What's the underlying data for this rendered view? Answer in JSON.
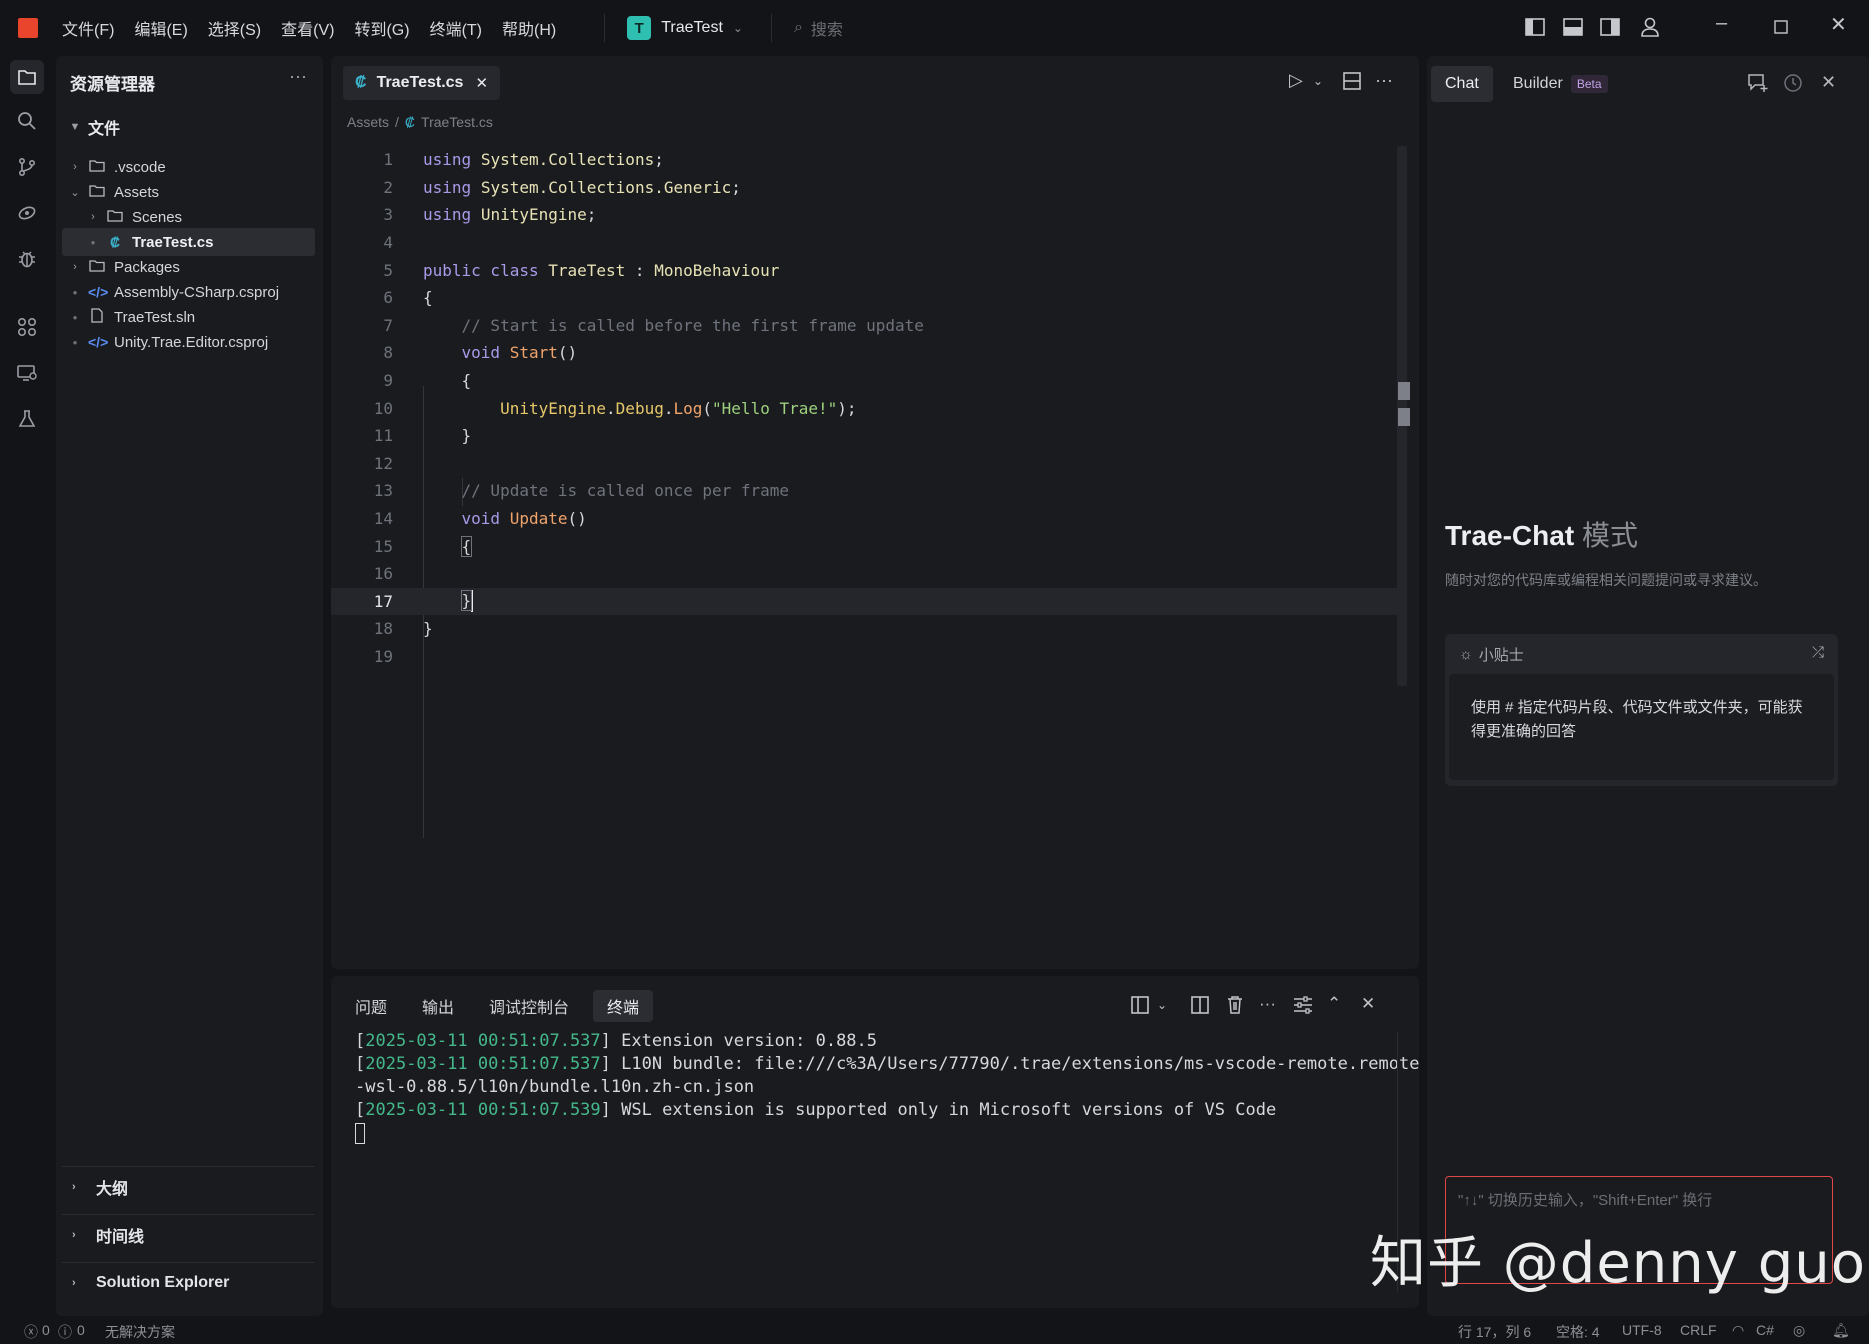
{
  "titlebar": {
    "menus": [
      "文件(F)",
      "编辑(E)",
      "选择(S)",
      "查看(V)",
      "转到(G)",
      "终端(T)",
      "帮助(H)"
    ],
    "project_badge": "T",
    "project_name": "TraeTest",
    "search_placeholder": "搜索"
  },
  "sidebar": {
    "title": "资源管理器",
    "more": "···",
    "root_label": "文件",
    "items": [
      {
        "label": ".vscode"
      },
      {
        "label": "Assets"
      },
      {
        "label": "Scenes"
      },
      {
        "label": "TraeTest.cs"
      },
      {
        "label": "Packages"
      },
      {
        "label": "Assembly-CSharp.csproj"
      },
      {
        "label": "TraeTest.sln"
      },
      {
        "label": "Unity.Trae.Editor.csproj"
      }
    ],
    "sections": [
      "大纲",
      "时间线",
      "Solution Explorer"
    ]
  },
  "editor": {
    "tab_label": "TraeTest.cs",
    "breadcrumb": [
      "Assets",
      "TraeTest.cs"
    ],
    "breadcrumb_sep": "/",
    "current_line": 17,
    "lines": [
      "using System.Collections;",
      "using System.Collections.Generic;",
      "using UnityEngine;",
      "",
      "public class TraeTest : MonoBehaviour",
      "{",
      "    // Start is called before the first frame update",
      "    void Start()",
      "    {",
      "        UnityEngine.Debug.Log(\"Hello Trae!\");",
      "    }",
      "",
      "    // Update is called once per frame",
      "    void Update()",
      "    {",
      "",
      "    }",
      "}",
      ""
    ]
  },
  "panel": {
    "tabs": [
      "问题",
      "输出",
      "调试控制台",
      "终端"
    ],
    "active_tab": "终端",
    "terminal": [
      {
        "ts": "2025-03-11 00:51:07.537",
        "msg": " Extension version: 0.88.5"
      },
      {
        "ts": "2025-03-11 00:51:07.537",
        "msg": " L10N bundle: file:///c%3A/Users/77790/.trae/extensions/ms-vscode-remote.remote"
      },
      {
        "ts": "",
        "msg": "-wsl-0.88.5/l10n/bundle.l10n.zh-cn.json"
      },
      {
        "ts": "2025-03-11 00:51:07.539",
        "msg": " WSL extension is supported only in Microsoft versions of VS Code"
      }
    ]
  },
  "chat": {
    "tab_chat": "Chat",
    "tab_builder": "Builder",
    "beta": "Beta",
    "title": "Trae-Chat",
    "title_mode": "模式",
    "subtitle": "随时对您的代码库或编程相关问题提问或寻求建议。",
    "tip_header": "小贴士",
    "tip_body": "使用 # 指定代码片段、代码文件或文件夹，可能获得更准确的回答",
    "input_placeholder": "\"↑↓\" 切换历史输入，\"Shift+Enter\" 换行"
  },
  "watermark": "知乎 @denny guo",
  "statusbar": {
    "errors": "0",
    "warnings": "0",
    "solution": "无解决方案",
    "position": "行 17，列 6",
    "spaces": "空格: 4",
    "encoding": "UTF-8",
    "eol": "CRLF",
    "language": "C#"
  }
}
